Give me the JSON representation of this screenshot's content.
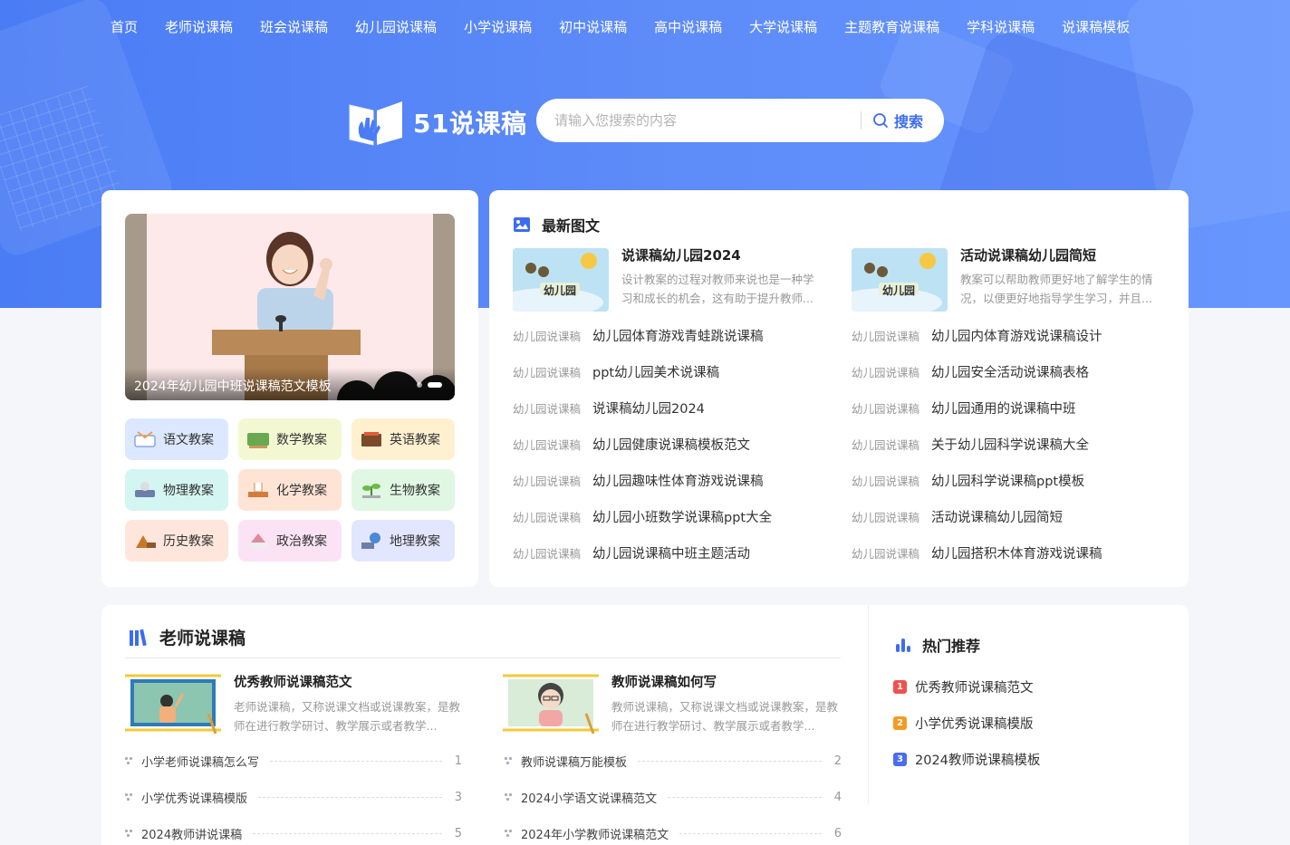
{
  "nav": [
    "首页",
    "老师说课稿",
    "班会说课稿",
    "幼儿园说课稿",
    "小学说课稿",
    "初中说课稿",
    "高中说课稿",
    "大学说课稿",
    "主题教育说课稿",
    "学科说课稿",
    "说课稿模板"
  ],
  "logo": {
    "title": "51说课稿"
  },
  "search": {
    "placeholder": "请输入您搜索的内容",
    "button": "搜索"
  },
  "banner": {
    "caption": "2024年幼儿园中班说课稿范文模板"
  },
  "subjects": [
    {
      "label": "语文教案",
      "bg": "#dbe8ff"
    },
    {
      "label": "数学教案",
      "bg": "#f3f8d2"
    },
    {
      "label": "英语教案",
      "bg": "#fff1d0"
    },
    {
      "label": "物理教案",
      "bg": "#d4f6f2"
    },
    {
      "label": "化学教案",
      "bg": "#ffe4d6"
    },
    {
      "label": "生物教案",
      "bg": "#dff7e3"
    },
    {
      "label": "历史教案",
      "bg": "#ffe6dc"
    },
    {
      "label": "政治教案",
      "bg": "#fbe3f5"
    },
    {
      "label": "地理教案",
      "bg": "#e3e6ff"
    }
  ],
  "latest": {
    "title": "最新图文",
    "featured": [
      {
        "title": "说课稿幼儿园2024",
        "desc": "设计教案的过程对教师来说也是一种学习和成长的机会，这有助于提升教师...",
        "thumb_text": "幼儿园"
      },
      {
        "title": "活动说课稿幼儿园简短",
        "desc": "教案可以帮助教师更好地了解学生的情况，以便更好地指导学生学习，并且...",
        "thumb_text": "幼儿园"
      }
    ],
    "left_list": [
      {
        "cat": "幼儿园说课稿",
        "name": "幼儿园体育游戏青蛙跳说课稿"
      },
      {
        "cat": "幼儿园说课稿",
        "name": "ppt幼儿园美术说课稿"
      },
      {
        "cat": "幼儿园说课稿",
        "name": "说课稿幼儿园2024"
      },
      {
        "cat": "幼儿园说课稿",
        "name": "幼儿园健康说课稿模板范文"
      },
      {
        "cat": "幼儿园说课稿",
        "name": "幼儿园趣味性体育游戏说课稿"
      },
      {
        "cat": "幼儿园说课稿",
        "name": "幼儿园小班数学说课稿ppt大全"
      },
      {
        "cat": "幼儿园说课稿",
        "name": "幼儿园说课稿中班主题活动"
      }
    ],
    "right_list": [
      {
        "cat": "幼儿园说课稿",
        "name": "幼儿园内体育游戏说课稿设计"
      },
      {
        "cat": "幼儿园说课稿",
        "name": "幼儿园安全活动说课稿表格"
      },
      {
        "cat": "幼儿园说课稿",
        "name": "幼儿园通用的说课稿中班"
      },
      {
        "cat": "幼儿园说课稿",
        "name": "关于幼儿园科学说课稿大全"
      },
      {
        "cat": "幼儿园说课稿",
        "name": "幼儿园科学说课稿ppt模板"
      },
      {
        "cat": "幼儿园说课稿",
        "name": "活动说课稿幼儿园简短"
      },
      {
        "cat": "幼儿园说课稿",
        "name": "幼儿园搭积木体育游戏说课稿"
      }
    ]
  },
  "teacher": {
    "title": "老师说课稿",
    "featured": [
      {
        "title": "优秀教师说课稿范文",
        "desc": "老师说课稿，又称说课文档或说课教案，是教师在进行教学研讨、教学展示或者教学..."
      },
      {
        "title": "教师说课稿如何写",
        "desc": "教师说课稿，又称说课文档或说课教案，是教师在进行教学研讨、教学展示或者教学..."
      }
    ],
    "left_list": [
      {
        "name": "小学老师说课稿怎么写",
        "num": "1"
      },
      {
        "name": "小学优秀说课稿模版",
        "num": "3"
      },
      {
        "name": "2024教师讲说课稿",
        "num": "5"
      }
    ],
    "right_list": [
      {
        "name": "教师说课稿万能模板",
        "num": "2"
      },
      {
        "name": "2024小学语文说课稿范文",
        "num": "4"
      },
      {
        "name": "2024年小学教师说课稿范文",
        "num": "6"
      }
    ]
  },
  "hot": {
    "title": "热门推荐",
    "items": [
      {
        "rank": "1",
        "name": "优秀教师说课稿范文",
        "color": "#f0524b"
      },
      {
        "rank": "2",
        "name": "小学优秀说课稿模版",
        "color": "#f59a23"
      },
      {
        "rank": "3",
        "name": "2024教师说课稿模板",
        "color": "#4a6cf0"
      }
    ]
  }
}
